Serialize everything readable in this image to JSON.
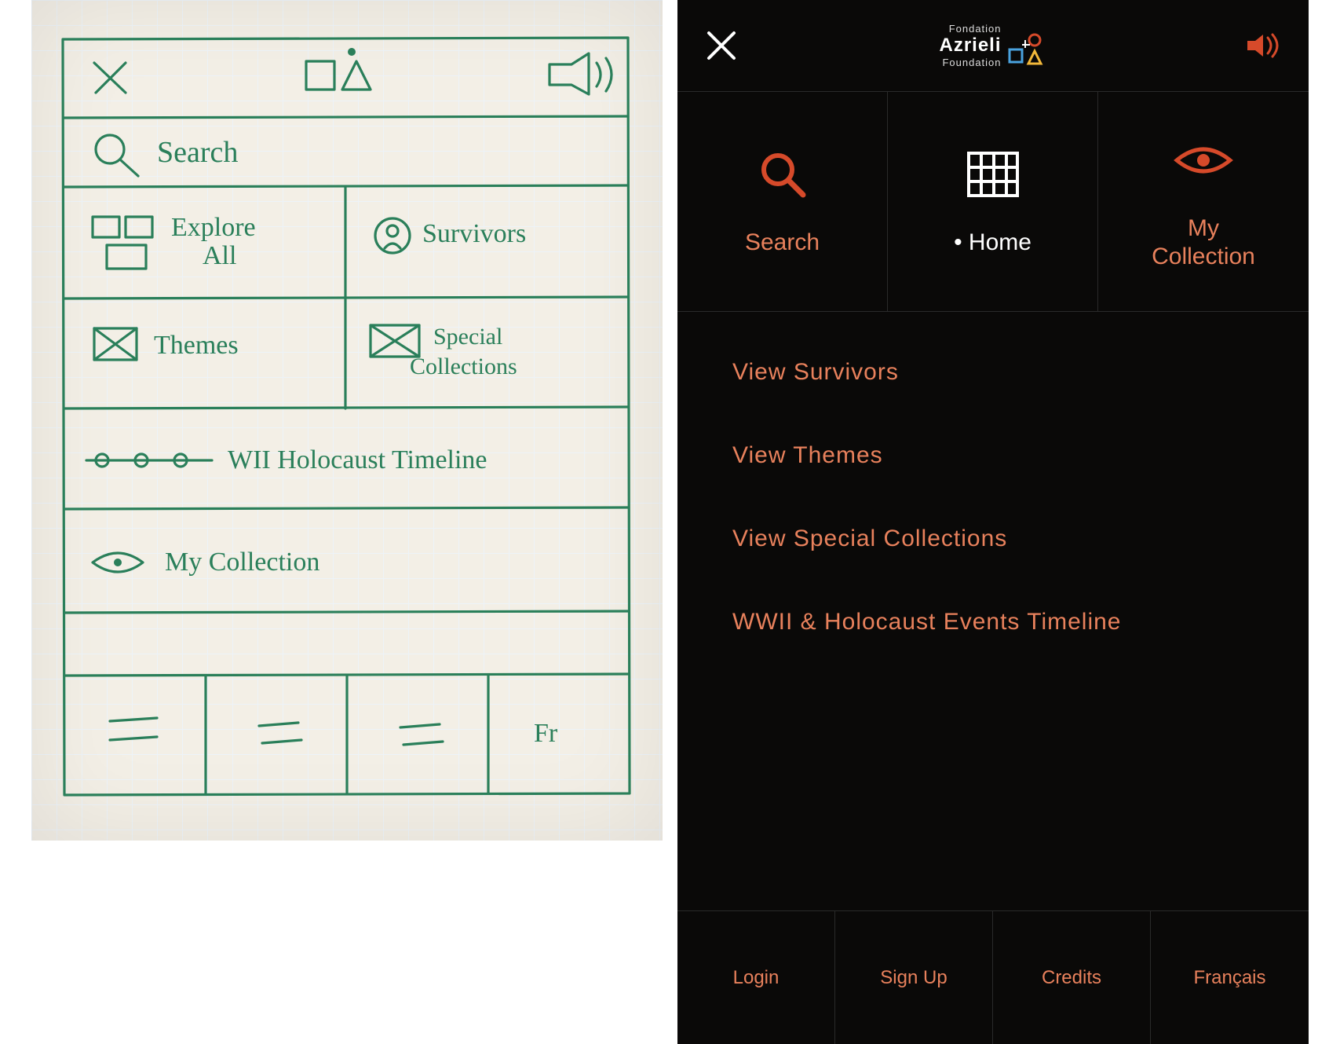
{
  "colors": {
    "accent": "#e8815c",
    "bg": "#0a0908",
    "pen": "#2a7f5a"
  },
  "sketch": {
    "header": {
      "close": "x",
      "logo": "logo",
      "sound": "sound"
    },
    "search_label": "Search",
    "tiles": [
      {
        "label": "Explore\nAll"
      },
      {
        "label": "Survivors"
      },
      {
        "label": "Themes"
      },
      {
        "label": "Special\nCollections"
      }
    ],
    "timeline_label": "WII Holocaust Timeline",
    "collection_label": "My Collection",
    "footer": [
      "=",
      "=",
      "=",
      "Fr"
    ]
  },
  "app": {
    "logo": {
      "top": "Fondation",
      "name": "Azrieli",
      "bottom": "Foundation"
    },
    "tiles": [
      {
        "key": "search",
        "label": "Search"
      },
      {
        "key": "home",
        "label": "Home"
      },
      {
        "key": "collection",
        "label": "My\nCollection"
      }
    ],
    "menu": [
      "View Survivors",
      "View Themes",
      "View Special Collections",
      "WWII & Holocaust Events Timeline"
    ],
    "footer": [
      "Login",
      "Sign Up",
      "Credits",
      "Français"
    ]
  }
}
